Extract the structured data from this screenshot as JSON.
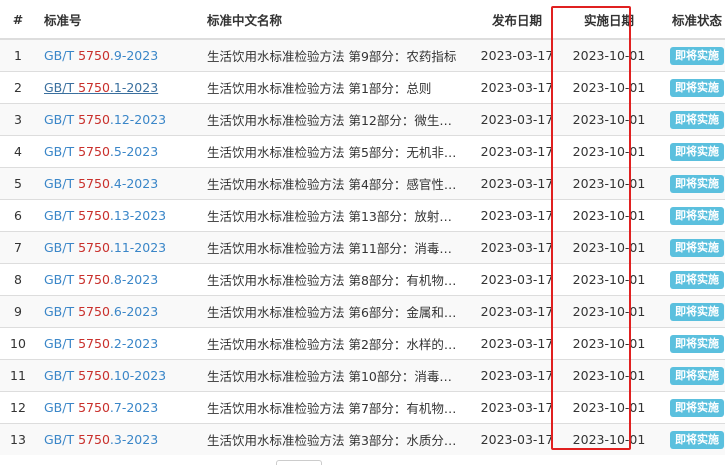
{
  "table": {
    "headers": {
      "num": "#",
      "code": "标准号",
      "name": "标准中文名称",
      "pub": "发布日期",
      "impl": "实施日期",
      "status": "标准状态"
    },
    "rows": [
      {
        "num": "1",
        "code_prefix": "GB/T ",
        "code_hl": "5750",
        "code_suffix": ".9-2023",
        "name": "生活饮用水标准检验方法 第9部分：农药指标",
        "pub": "2023-03-17",
        "impl": "2023-10-01",
        "status": "即将实施"
      },
      {
        "num": "2",
        "code_prefix": "GB/T ",
        "code_hl": "5750",
        "code_suffix": ".1-2023",
        "name": "生活饮用水标准检验方法 第1部分：总则",
        "pub": "2023-03-17",
        "impl": "2023-10-01",
        "status": "即将实施"
      },
      {
        "num": "3",
        "code_prefix": "GB/T ",
        "code_hl": "5750",
        "code_suffix": ".12-2023",
        "name": "生活饮用水标准检验方法 第12部分：微生…",
        "pub": "2023-03-17",
        "impl": "2023-10-01",
        "status": "即将实施"
      },
      {
        "num": "4",
        "code_prefix": "GB/T ",
        "code_hl": "5750",
        "code_suffix": ".5-2023",
        "name": "生活饮用水标准检验方法 第5部分：无机非…",
        "pub": "2023-03-17",
        "impl": "2023-10-01",
        "status": "即将实施"
      },
      {
        "num": "5",
        "code_prefix": "GB/T ",
        "code_hl": "5750",
        "code_suffix": ".4-2023",
        "name": "生活饮用水标准检验方法 第4部分：感官性…",
        "pub": "2023-03-17",
        "impl": "2023-10-01",
        "status": "即将实施"
      },
      {
        "num": "6",
        "code_prefix": "GB/T ",
        "code_hl": "5750",
        "code_suffix": ".13-2023",
        "name": "生活饮用水标准检验方法 第13部分：放射…",
        "pub": "2023-03-17",
        "impl": "2023-10-01",
        "status": "即将实施"
      },
      {
        "num": "7",
        "code_prefix": "GB/T ",
        "code_hl": "5750",
        "code_suffix": ".11-2023",
        "name": "生活饮用水标准检验方法 第11部分：消毒…",
        "pub": "2023-03-17",
        "impl": "2023-10-01",
        "status": "即将实施"
      },
      {
        "num": "8",
        "code_prefix": "GB/T ",
        "code_hl": "5750",
        "code_suffix": ".8-2023",
        "name": "生活饮用水标准检验方法 第8部分：有机物…",
        "pub": "2023-03-17",
        "impl": "2023-10-01",
        "status": "即将实施"
      },
      {
        "num": "9",
        "code_prefix": "GB/T ",
        "code_hl": "5750",
        "code_suffix": ".6-2023",
        "name": "生活饮用水标准检验方法 第6部分：金属和…",
        "pub": "2023-03-17",
        "impl": "2023-10-01",
        "status": "即将实施"
      },
      {
        "num": "10",
        "code_prefix": "GB/T ",
        "code_hl": "5750",
        "code_suffix": ".2-2023",
        "name": "生活饮用水标准检验方法 第2部分：水样的…",
        "pub": "2023-03-17",
        "impl": "2023-10-01",
        "status": "即将实施"
      },
      {
        "num": "11",
        "code_prefix": "GB/T ",
        "code_hl": "5750",
        "code_suffix": ".10-2023",
        "name": "生活饮用水标准检验方法 第10部分：消毒…",
        "pub": "2023-03-17",
        "impl": "2023-10-01",
        "status": "即将实施"
      },
      {
        "num": "12",
        "code_prefix": "GB/T ",
        "code_hl": "5750",
        "code_suffix": ".7-2023",
        "name": "生活饮用水标准检验方法 第7部分：有机物…",
        "pub": "2023-03-17",
        "impl": "2023-10-01",
        "status": "即将实施"
      },
      {
        "num": "13",
        "code_prefix": "GB/T ",
        "code_hl": "5750",
        "code_suffix": ".3-2023",
        "name": "生活饮用水标准检验方法 第3部分：水质分…",
        "pub": "2023-03-17",
        "impl": "2023-10-01",
        "status": "即将实施"
      }
    ]
  },
  "colors": {
    "link": "#3a86c8",
    "highlight": "#c9302c",
    "badge": "#5bc0de",
    "annotation_box": "#e02020"
  }
}
